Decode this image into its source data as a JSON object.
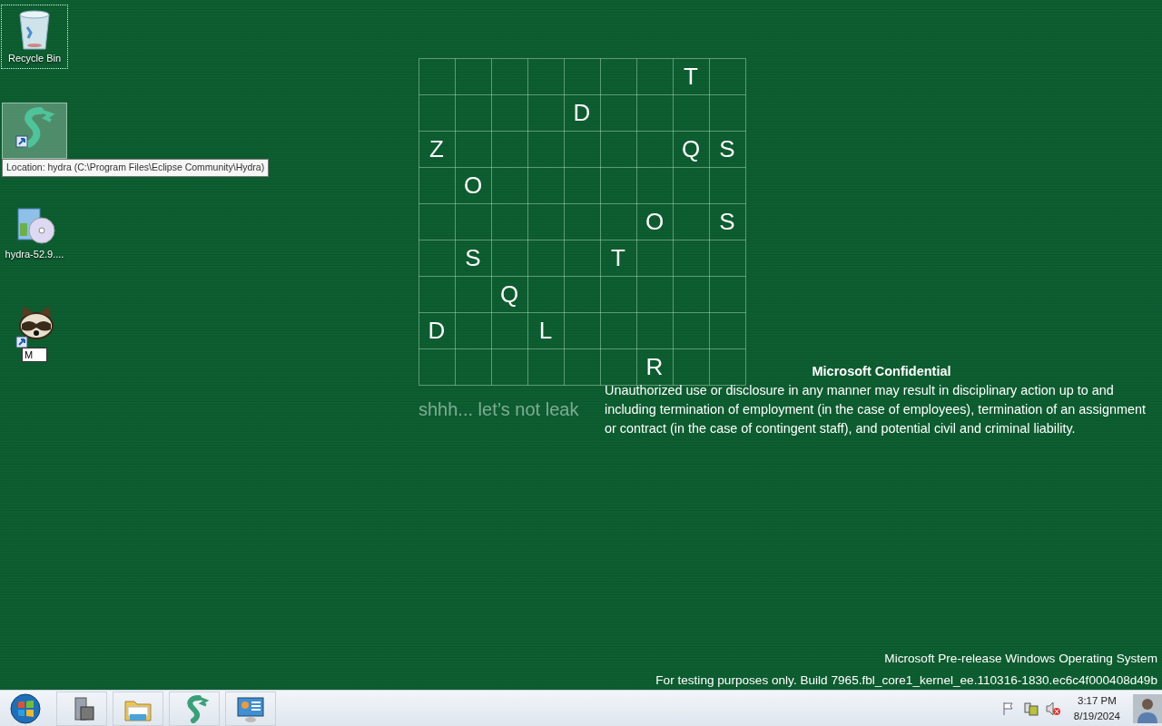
{
  "desktop_icons": [
    {
      "kind": "recycle",
      "label": "Recycle Bin",
      "selected": true
    },
    {
      "kind": "hydra",
      "hovered": true
    },
    {
      "kind": "installer",
      "label": "hydra-52.9...."
    },
    {
      "kind": "raccoon",
      "rename_value": "M"
    }
  ],
  "tooltip": "Location: hydra (C:\\Program Files\\Eclipse Community\\Hydra)",
  "wallpaper": {
    "grid": [
      [
        {
          "kind": "blank"
        },
        {
          "kind": "blank"
        },
        {
          "kind": "blank"
        },
        {
          "kind": "blank"
        },
        {
          "kind": "blank"
        },
        {
          "kind": "blank"
        },
        {
          "kind": "blank"
        },
        {
          "kind": "letter",
          "letter": "T"
        },
        {
          "kind": "blank"
        }
      ],
      [
        {
          "kind": "blank"
        },
        {
          "kind": "blank"
        },
        {
          "kind": "blank"
        },
        {
          "kind": "blank"
        },
        {
          "kind": "letter",
          "letter": "D"
        },
        {
          "kind": "blank"
        },
        {
          "kind": "blank"
        },
        {
          "kind": "blank"
        },
        {
          "kind": "blank"
        }
      ],
      [
        {
          "kind": "letter",
          "letter": "Z"
        },
        {
          "kind": "blank"
        },
        {
          "kind": "blank"
        },
        {
          "kind": "blank"
        },
        {
          "kind": "blank"
        },
        {
          "kind": "blank"
        },
        {
          "kind": "blank"
        },
        {
          "kind": "letter",
          "letter": "Q"
        },
        {
          "kind": "letter",
          "letter": "S"
        }
      ],
      [
        {
          "kind": "blank"
        },
        {
          "kind": "letter",
          "letter": "O"
        },
        {
          "kind": "blank"
        },
        {
          "kind": "blank"
        },
        {
          "kind": "blank"
        },
        {
          "kind": "blank"
        },
        {
          "kind": "blank"
        },
        {
          "kind": "blank"
        },
        {
          "kind": "blank"
        }
      ],
      [
        {
          "kind": "blank"
        },
        {
          "kind": "blank"
        },
        {
          "kind": "blank"
        },
        {
          "kind": "blank"
        },
        {
          "kind": "blank"
        },
        {
          "kind": "blank"
        },
        {
          "kind": "letter",
          "letter": "O"
        },
        {
          "kind": "blank"
        },
        {
          "kind": "letter",
          "letter": "S"
        }
      ],
      [
        {
          "kind": "blank"
        },
        {
          "kind": "letter",
          "letter": "S"
        },
        {
          "kind": "blank"
        },
        {
          "kind": "blank"
        },
        {
          "kind": "blank"
        },
        {
          "kind": "letter",
          "letter": "T"
        },
        {
          "kind": "blank"
        },
        {
          "kind": "blank"
        },
        {
          "kind": "blank"
        }
      ],
      [
        {
          "kind": "blank"
        },
        {
          "kind": "blank"
        },
        {
          "kind": "letter",
          "letter": "Q"
        },
        {
          "kind": "blank"
        },
        {
          "kind": "blank"
        },
        {
          "kind": "blank"
        },
        {
          "kind": "blank"
        },
        {
          "kind": "blank"
        },
        {
          "kind": "blank"
        }
      ],
      [
        {
          "kind": "letter",
          "letter": "D"
        },
        {
          "kind": "blank"
        },
        {
          "kind": "blank"
        },
        {
          "kind": "letter",
          "letter": "L"
        },
        {
          "kind": "blank"
        },
        {
          "kind": "blank"
        },
        {
          "kind": "blank"
        },
        {
          "kind": "blank"
        },
        {
          "kind": "blank"
        }
      ],
      [
        {
          "kind": "blank"
        },
        {
          "kind": "blank"
        },
        {
          "kind": "blank"
        },
        {
          "kind": "blank"
        },
        {
          "kind": "blank"
        },
        {
          "kind": "blank"
        },
        {
          "kind": "letter",
          "letter": "R"
        },
        {
          "kind": "blank"
        },
        {
          "kind": "blank"
        }
      ]
    ],
    "caption": "shhh... let’s not leak"
  },
  "confidential": {
    "title": "Microsoft Confidential",
    "body": "Unauthorized use or disclosure in any manner may result in disciplinary action up to and including termination of employment (in the case of employees), termination of an assignment or contract (in the case of contingent staff), and potential civil and criminal liability."
  },
  "watermark": {
    "line_1": "Microsoft Pre-release Windows Operating System",
    "line_2": "For testing purposes only. Build 7965.fbl_core1_kernel_ee.110316-1830.ec6c4f000408d49b"
  },
  "taskbar": {
    "items": [
      {
        "kind": "server"
      },
      {
        "kind": "folder"
      },
      {
        "kind": "hydra"
      },
      {
        "kind": "panel"
      }
    ],
    "tray": [
      {
        "kind": "flag"
      },
      {
        "kind": "network"
      },
      {
        "kind": "volume-muted"
      }
    ],
    "time": "3:17 PM",
    "date": "8/19/2024"
  }
}
